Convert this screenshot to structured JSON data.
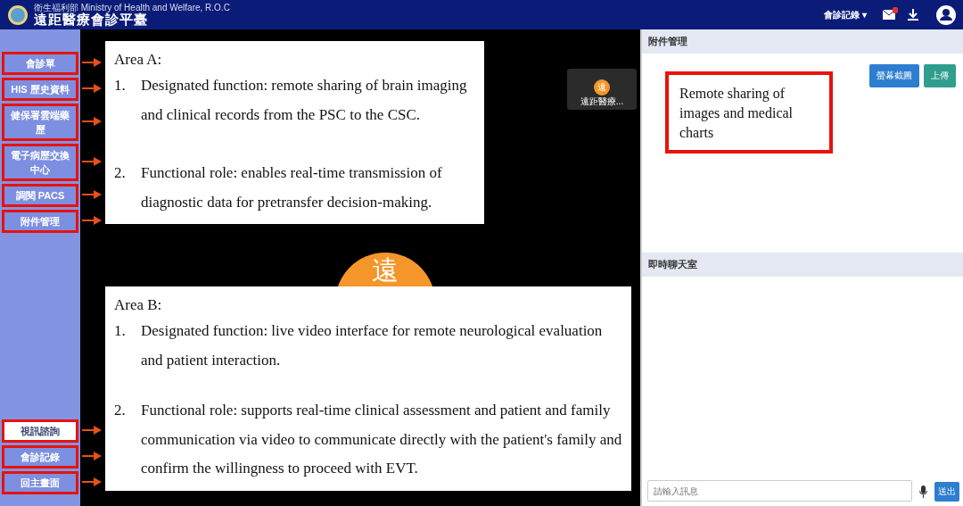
{
  "header": {
    "ministry": "衛生福利部 Ministry of Health and Welfare, R.O.C",
    "title": "遠距醫療會診平臺",
    "menu": "會診記錄",
    "menu_caret": "▾"
  },
  "sidebar": {
    "top_items": [
      {
        "label": "會診單",
        "selected": false,
        "highlighted": true
      },
      {
        "label": "HIS 歷史資料",
        "selected": false,
        "highlighted": true
      },
      {
        "label": "健保署雲端藥歷",
        "selected": false,
        "highlighted": true
      },
      {
        "label": "電子病歷交換中心",
        "selected": false,
        "highlighted": true
      },
      {
        "label": "調閱 PACS",
        "selected": false,
        "highlighted": true
      },
      {
        "label": "附件管理",
        "selected": false,
        "highlighted": true
      }
    ],
    "bottom_items": [
      {
        "label": "視訊諮詢",
        "selected": true,
        "highlighted": true
      },
      {
        "label": "會診記錄",
        "selected": false,
        "highlighted": true
      },
      {
        "label": "回主畫面",
        "selected": false,
        "highlighted": true
      }
    ]
  },
  "video": {
    "avatar_text": "遠",
    "thumbnail": {
      "avatar_text": "遠",
      "name": "遠距醫療..."
    }
  },
  "attachments": {
    "title": "附件管理",
    "buttons": [
      {
        "label": "螢幕截圖",
        "kind": "primary"
      },
      {
        "label": "上傳",
        "kind": "success"
      }
    ]
  },
  "chat": {
    "title": "即時聊天室",
    "placeholder": "請輸入訊息",
    "send": "送出"
  },
  "annotations": {
    "area_a": {
      "title": "Area A:",
      "items": [
        {
          "number": "1.",
          "text": "Designated function: remote sharing of brain imaging and clinical records from the PSC to the CSC."
        },
        {
          "number": "2.",
          "text": "Functional role: enables real-time transmission of diagnostic data for pretransfer decision-making."
        }
      ]
    },
    "area_b": {
      "title": "Area B:",
      "items": [
        {
          "number": "1.",
          "text": "Designated function: live video interface for remote neurological evaluation and patient interaction."
        },
        {
          "number": "2.",
          "text": "Functional role: supports real-time clinical assessment and patient and family communication via video to communicate directly with the patient's family and confirm the willingness to proceed with EVT."
        }
      ]
    },
    "callout": "Remote sharing of images and medical charts"
  }
}
